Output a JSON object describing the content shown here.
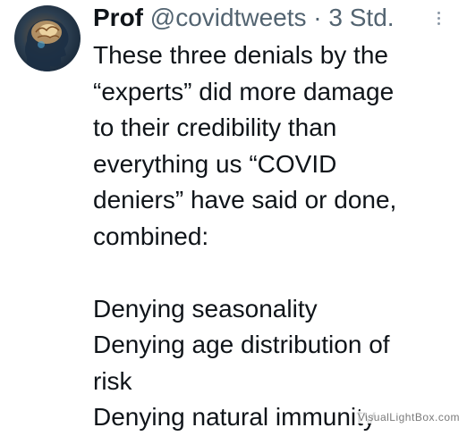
{
  "tweet": {
    "author_name": "Prof",
    "handle": "@covidtweets",
    "separator": "·",
    "time": "3 Std.",
    "menu_icon": "more-vertical-icon",
    "avatar_icon": "brain-head-avatar",
    "paragraph1": [
      "These three denials by the",
      "“experts” did more damage",
      "to their credibility than",
      "everything us “COVID",
      "deniers” have said or done,",
      "combined:"
    ],
    "list": [
      "Denying seasonality",
      "Denying age distribution of",
      "risk",
      "Denying natural immunity"
    ]
  },
  "watermark": "VisualLightBox.com",
  "colors": {
    "text": "#0f1419",
    "secondary": "#536471",
    "background": "#ffffff"
  }
}
